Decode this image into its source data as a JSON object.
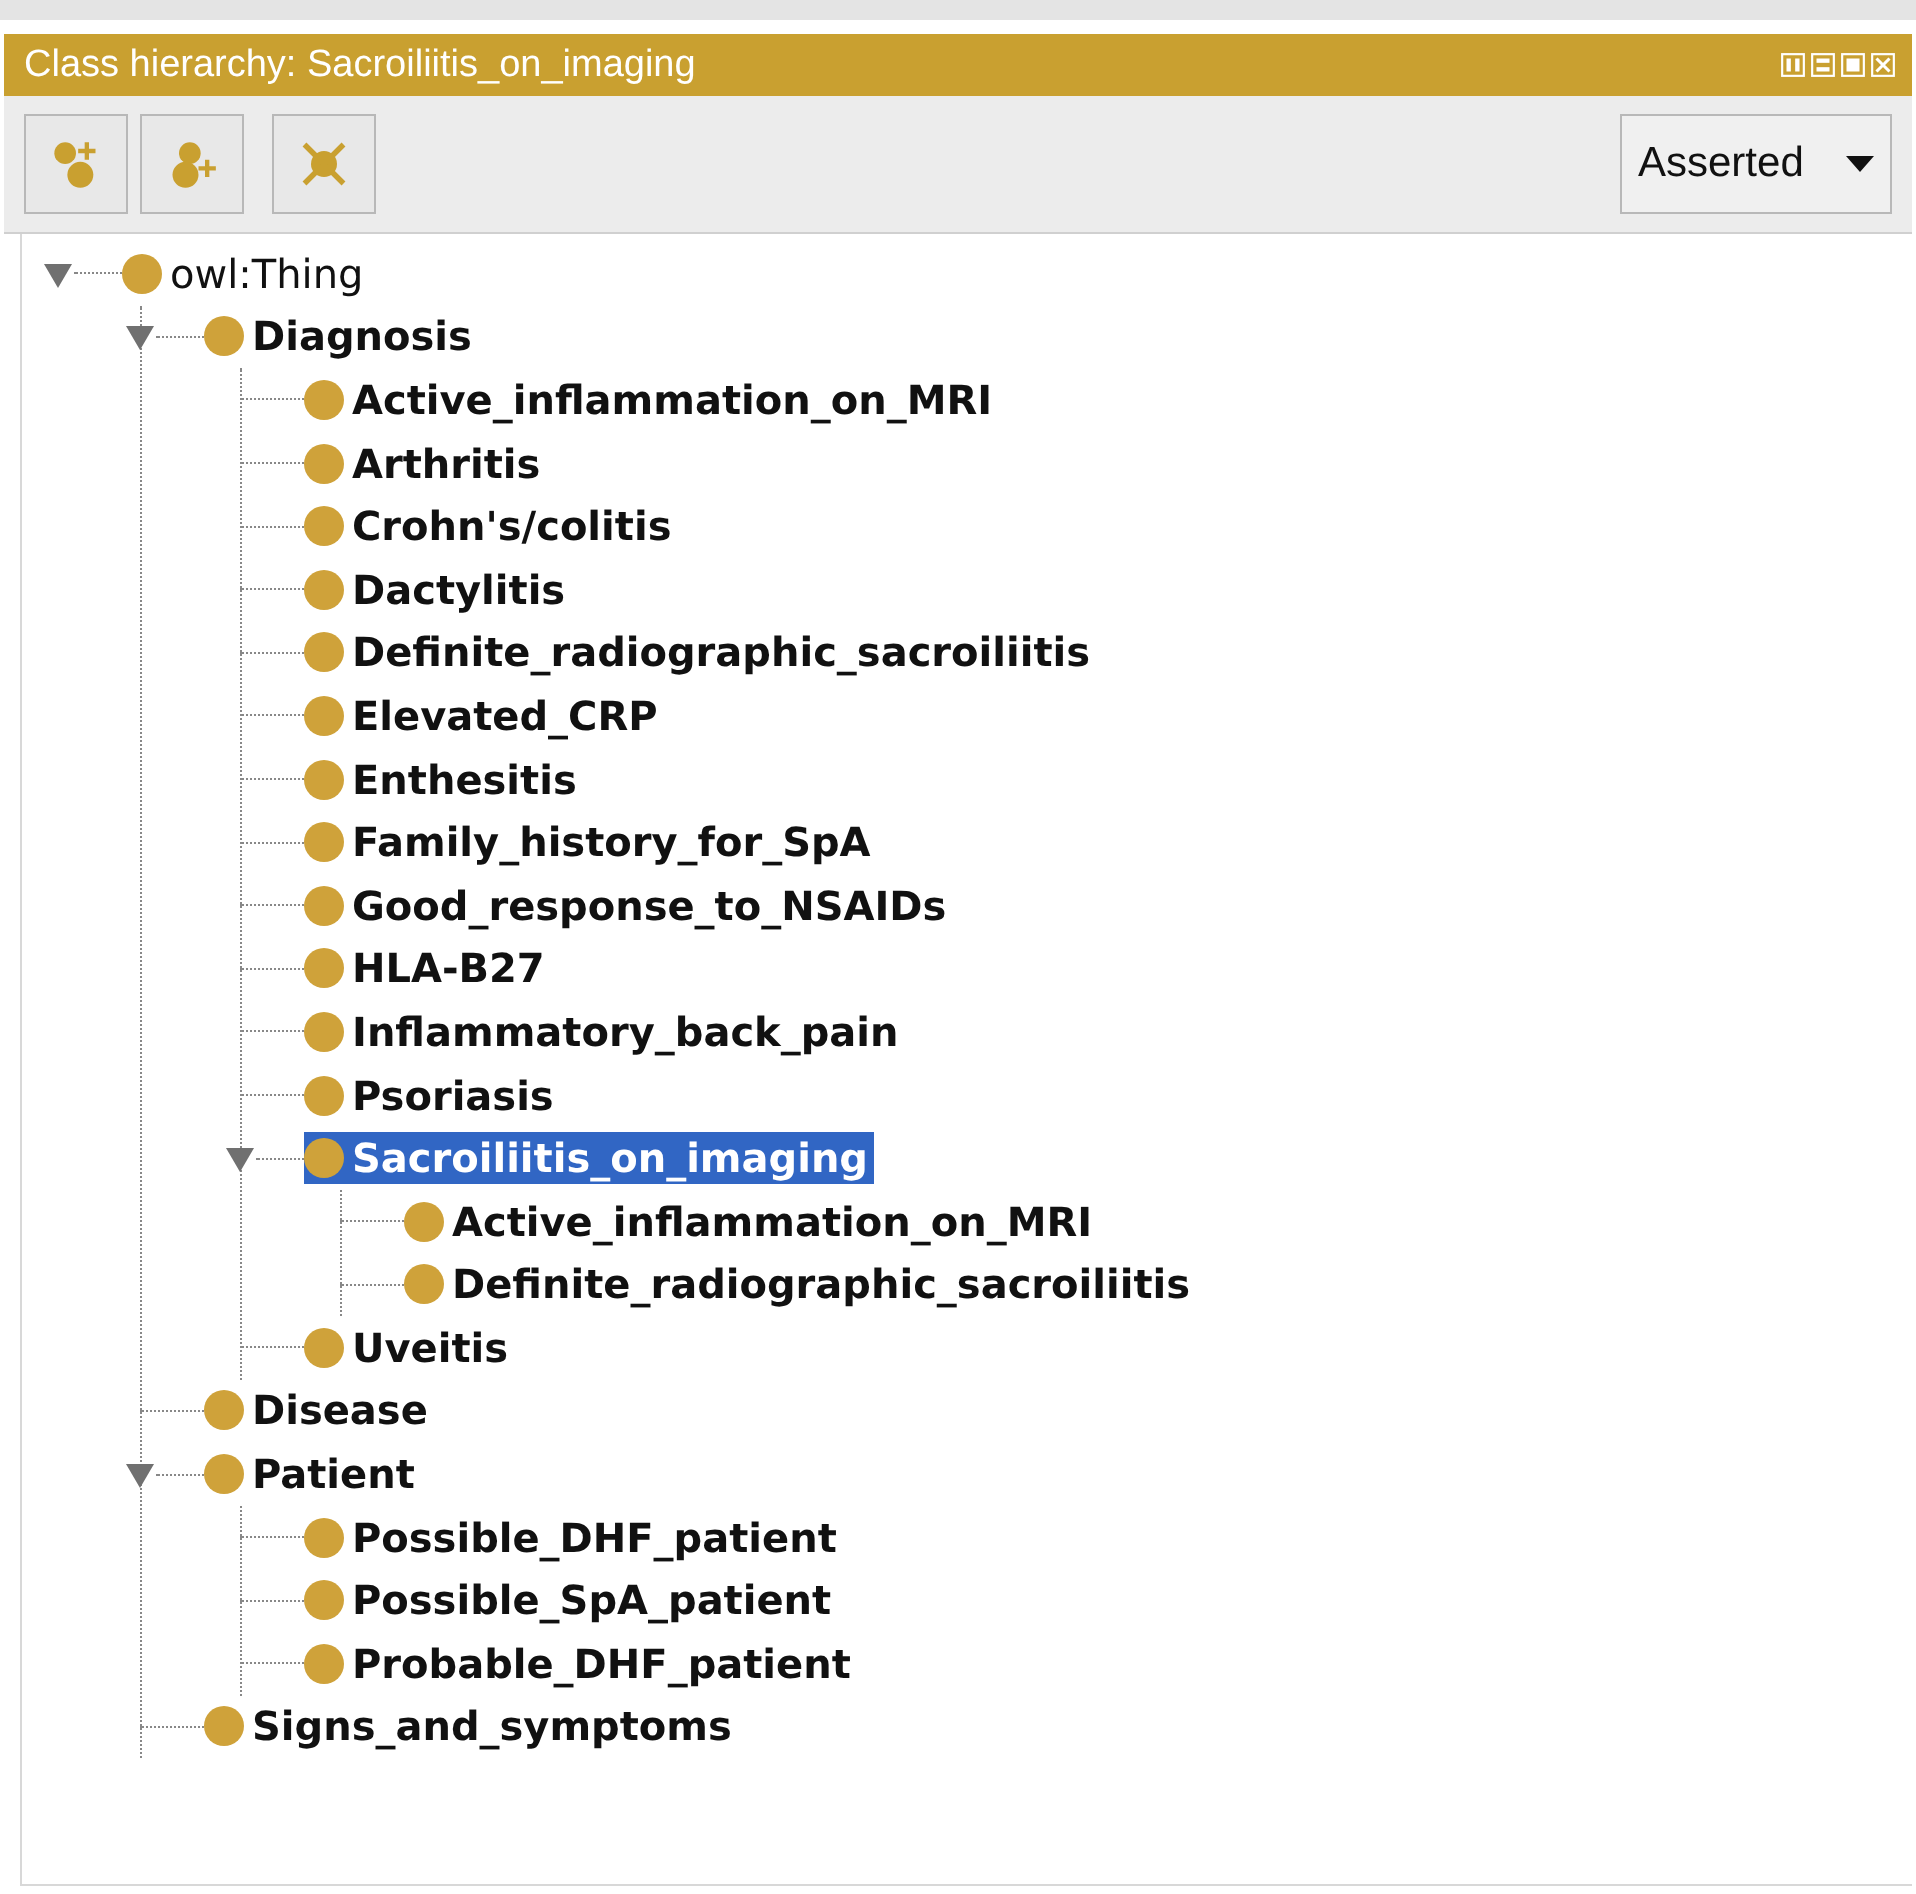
{
  "panel": {
    "title": "Class hierarchy: Sacroiliitis_on_imaging"
  },
  "toolbar": {
    "view_selector": {
      "value": "Asserted"
    }
  },
  "tree": [
    {
      "label": "owl:Thing",
      "bold": false,
      "expanded": true,
      "selected": false,
      "children": [
        {
          "label": "Diagnosis",
          "bold": true,
          "expanded": true,
          "selected": false,
          "children": [
            {
              "label": "Active_inflammation_on_MRI",
              "bold": true,
              "selected": false
            },
            {
              "label": "Arthritis",
              "bold": true,
              "selected": false
            },
            {
              "label": "Crohn's/colitis",
              "bold": true,
              "selected": false
            },
            {
              "label": "Dactylitis",
              "bold": true,
              "selected": false
            },
            {
              "label": "Definite_radiographic_sacroiliitis",
              "bold": true,
              "selected": false
            },
            {
              "label": "Elevated_CRP",
              "bold": true,
              "selected": false
            },
            {
              "label": "Enthesitis",
              "bold": true,
              "selected": false
            },
            {
              "label": "Family_history_for_SpA",
              "bold": true,
              "selected": false
            },
            {
              "label": "Good_response_to_NSAIDs",
              "bold": true,
              "selected": false
            },
            {
              "label": "HLA-B27",
              "bold": true,
              "selected": false
            },
            {
              "label": "Inflammatory_back_pain",
              "bold": true,
              "selected": false
            },
            {
              "label": "Psoriasis",
              "bold": true,
              "selected": false
            },
            {
              "label": "Sacroiliitis_on_imaging",
              "bold": true,
              "expanded": true,
              "selected": true,
              "children": [
                {
                  "label": "Active_inflammation_on_MRI",
                  "bold": true,
                  "selected": false
                },
                {
                  "label": "Definite_radiographic_sacroiliitis",
                  "bold": true,
                  "selected": false
                }
              ]
            },
            {
              "label": "Uveitis",
              "bold": true,
              "selected": false
            }
          ]
        },
        {
          "label": "Disease",
          "bold": true,
          "selected": false
        },
        {
          "label": "Patient",
          "bold": true,
          "expanded": true,
          "selected": false,
          "children": [
            {
              "label": "Possible_DHF_patient",
              "bold": true,
              "selected": false
            },
            {
              "label": "Possible_SpA_patient",
              "bold": true,
              "selected": false
            },
            {
              "label": "Probable_DHF_patient",
              "bold": true,
              "selected": false
            }
          ]
        },
        {
          "label": "Signs_and_symptoms",
          "bold": true,
          "selected": false
        }
      ]
    }
  ]
}
